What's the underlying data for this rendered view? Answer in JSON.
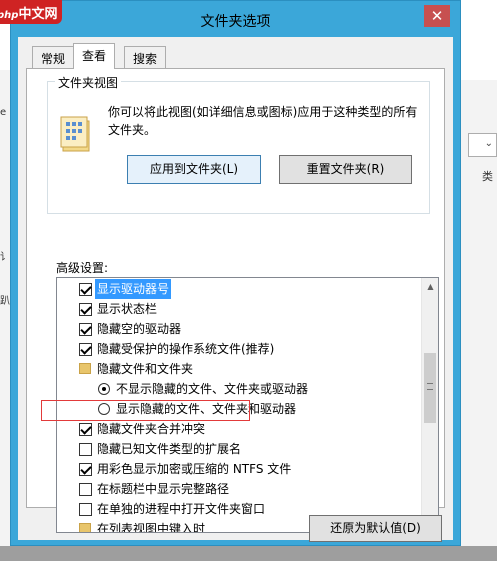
{
  "logo": {
    "php": "php",
    "cn": "中文网"
  },
  "window": {
    "title": "文件夹选项",
    "close": "✕"
  },
  "tabs": [
    "常规",
    "查看",
    "搜索"
  ],
  "folder_views": {
    "legend": "文件夹视图",
    "description": "你可以将此视图(如详细信息或图标)应用于这种类型的所有文件夹。",
    "apply_button": "应用到文件夹(L)",
    "reset_button": "重置文件夹(R)"
  },
  "advanced": {
    "label": "高级设置:",
    "items": [
      {
        "type": "checkbox",
        "checked": true,
        "label": "显示驱动器号",
        "selected": true
      },
      {
        "type": "checkbox",
        "checked": true,
        "label": "显示状态栏"
      },
      {
        "type": "checkbox",
        "checked": true,
        "label": "隐藏空的驱动器"
      },
      {
        "type": "checkbox",
        "checked": true,
        "label": "隐藏受保护的操作系统文件(推荐)"
      },
      {
        "type": "folder",
        "label": "隐藏文件和文件夹"
      },
      {
        "type": "radio",
        "checked": true,
        "label": "不显示隐藏的文件、文件夹或驱动器"
      },
      {
        "type": "radio",
        "checked": false,
        "label": "显示隐藏的文件、文件夹和驱动器"
      },
      {
        "type": "checkbox",
        "checked": true,
        "label": "隐藏文件夹合并冲突"
      },
      {
        "type": "checkbox",
        "checked": false,
        "label": "隐藏已知文件类型的扩展名"
      },
      {
        "type": "checkbox",
        "checked": true,
        "label": "用彩色显示加密或压缩的 NTFS 文件"
      },
      {
        "type": "checkbox",
        "checked": false,
        "label": "在标题栏中显示完整路径"
      },
      {
        "type": "checkbox",
        "checked": false,
        "label": "在单独的进程中打开文件夹窗口"
      },
      {
        "type": "folder",
        "label": "在列表视图中键入时"
      }
    ]
  },
  "restore_button": "还原为默认值(D)",
  "background": {
    "left_chars": [
      "e",
      "讠",
      "趴"
    ],
    "right_label": "类"
  },
  "colors": {
    "title_bar": "#3ba7d9",
    "selection": "#3399ff",
    "highlight": "#e23a3a"
  }
}
